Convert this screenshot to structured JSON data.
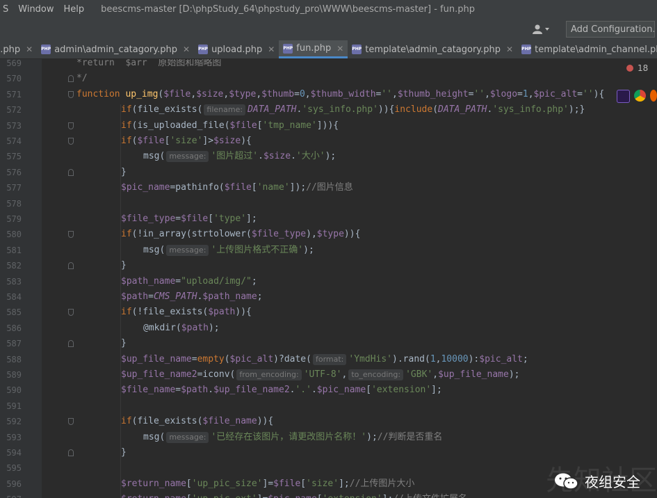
{
  "menu": {
    "items": [
      "S",
      "Window",
      "Help"
    ],
    "title": "beescms-master [D:\\phpStudy_64\\phpstudy_pro\\WWW\\beescms-master] - fun.php"
  },
  "toolbar": {
    "add_config": "Add Configuration..."
  },
  "tabs": [
    {
      "label": "p.php",
      "active": false
    },
    {
      "label": "admin\\admin_catagory.php",
      "active": false
    },
    {
      "label": "upload.php",
      "active": false
    },
    {
      "label": "fun.php",
      "active": true
    },
    {
      "label": "template\\admin_catagory.php",
      "active": false
    },
    {
      "label": "template\\admin_channel.php",
      "active": false
    }
  ],
  "editor": {
    "error_count": "18"
  },
  "lines": [
    {
      "n": "569",
      "text": "*return  $arr  原始图和缩略图"
    },
    {
      "n": "570",
      "text": "*/"
    },
    {
      "n": "571",
      "text": "function up_img($file,$size,$type,$thumb=0,$thumb_width='',$thumb_height='',$logo=1,$pic_alt=''){"
    },
    {
      "n": "572",
      "text": "if(file_exists( filename: DATA_PATH.'sys_info.php')){include(DATA_PATH.'sys_info.php');}"
    },
    {
      "n": "573",
      "text": "if(is_uploaded_file($file['tmp_name'])){"
    },
    {
      "n": "574",
      "text": "if($file['size']>$size){"
    },
    {
      "n": "575",
      "text": "msg( message: '图片超过'.$size.'大小');"
    },
    {
      "n": "576",
      "text": "}"
    },
    {
      "n": "577",
      "text": "$pic_name=pathinfo($file['name']);//图片信息"
    },
    {
      "n": "578",
      "text": ""
    },
    {
      "n": "579",
      "text": "$file_type=$file['type'];"
    },
    {
      "n": "580",
      "text": "if(!in_array(strtolower($file_type),$type)){"
    },
    {
      "n": "581",
      "text": "msg( message: '上传图片格式不正确');"
    },
    {
      "n": "582",
      "text": "}"
    },
    {
      "n": "583",
      "text": "$path_name=\"upload/img/\";"
    },
    {
      "n": "584",
      "text": "$path=CMS_PATH.$path_name;"
    },
    {
      "n": "585",
      "text": "if(!file_exists($path)){"
    },
    {
      "n": "586",
      "text": "@mkdir($path);"
    },
    {
      "n": "587",
      "text": "}"
    },
    {
      "n": "588",
      "text": "$up_file_name=empty($pic_alt)?date( format: 'YmdHis').rand(1,10000):$pic_alt;"
    },
    {
      "n": "589",
      "text": "$up_file_name2=iconv( from_encoding: 'UTF-8', to_encoding: 'GBK',$up_file_name);"
    },
    {
      "n": "590",
      "text": "$file_name=$path.$up_file_name2.'.'.$pic_name['extension'];"
    },
    {
      "n": "591",
      "text": ""
    },
    {
      "n": "592",
      "text": "if(file_exists($file_name)){"
    },
    {
      "n": "593",
      "text": "msg( message: '已经存在该图片，请更改图片名称！');//判断是否重名"
    },
    {
      "n": "594",
      "text": "}"
    },
    {
      "n": "595",
      "text": ""
    },
    {
      "n": "596",
      "text": "$return_name['up_pic_size']=$file['size'];//上传图片大小"
    },
    {
      "n": "597",
      "text": "$return_name['up_pic_ext']=$pic_name['extension'];//上传文件扩展名"
    }
  ],
  "watermark": {
    "text": "夜组安全",
    "bg_text": "先知社区"
  },
  "colors": {
    "accent": "#4a88c7",
    "error": "#c75450",
    "background": "#2b2b2b"
  }
}
